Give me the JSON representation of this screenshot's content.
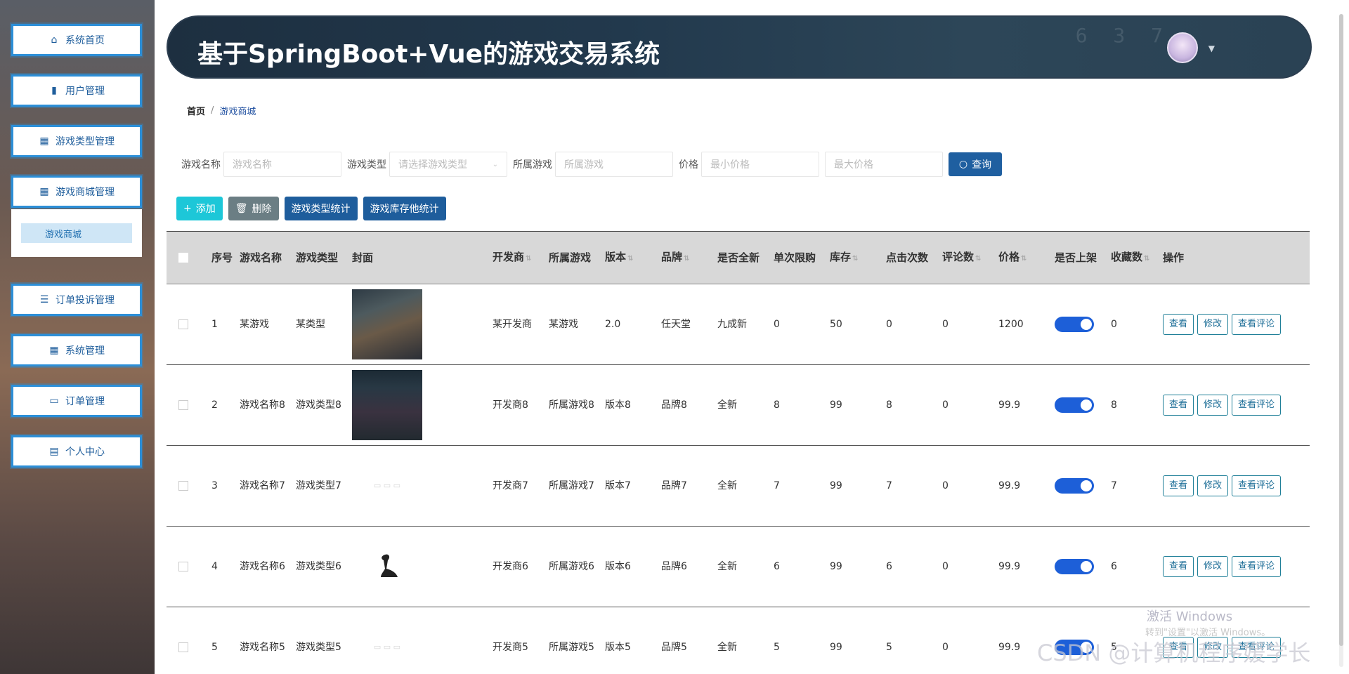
{
  "app_title": "基于SpringBoot+Vue的游戏交易系统",
  "sidebar": {
    "items": [
      {
        "label": "系统首页",
        "icon": "home-icon"
      },
      {
        "label": "用户管理",
        "icon": "bar-chart-icon"
      },
      {
        "label": "游戏类型管理",
        "icon": "grid-icon"
      },
      {
        "label": "游戏商城管理",
        "icon": "grid-icon"
      },
      {
        "label": "订单投诉管理",
        "icon": "list-icon"
      },
      {
        "label": "系统管理",
        "icon": "apps-icon"
      },
      {
        "label": "订单管理",
        "icon": "monitor-icon"
      },
      {
        "label": "个人中心",
        "icon": "calendar-icon"
      }
    ],
    "subitem": "游戏商城"
  },
  "breadcrumb": {
    "home": "首页",
    "sep": "/",
    "current": "游戏商城"
  },
  "search": {
    "name_label": "游戏名称",
    "name_placeholder": "游戏名称",
    "type_label": "游戏类型",
    "type_placeholder": "请选择游戏类型",
    "belong_label": "所属游戏",
    "belong_placeholder": "所属游戏",
    "price_label": "价格",
    "min_placeholder": "最小价格",
    "max_placeholder": "最大价格",
    "query_label": "查询"
  },
  "actions": {
    "add": "添加",
    "delete": "删除",
    "type_stat": "游戏类型统计",
    "stock_stat": "游戏库存他统计"
  },
  "table": {
    "headers": {
      "idx": "序号",
      "name": "游戏名称",
      "type": "游戏类型",
      "cover": "封面",
      "dev": "开发商",
      "belong": "所属游戏",
      "ver": "版本",
      "brand": "品牌",
      "new": "是否全新",
      "limit": "单次限购",
      "stock": "库存",
      "clicks": "点击次数",
      "comments": "评论数",
      "price": "价格",
      "onsale": "是否上架",
      "fav": "收藏数",
      "ops": "操作"
    },
    "op_labels": {
      "view": "查看",
      "edit": "修改",
      "comments": "查看评论"
    },
    "rows": [
      {
        "idx": "1",
        "name": "某游戏",
        "type": "某类型",
        "dev": "某开发商",
        "belong": "某游戏",
        "ver": "2.0",
        "brand": "任天堂",
        "new": "九成新",
        "limit": "0",
        "stock": "50",
        "clicks": "0",
        "comments": "0",
        "price": "1200",
        "fav": "0"
      },
      {
        "idx": "2",
        "name": "游戏名称8",
        "type": "游戏类型8",
        "dev": "开发商8",
        "belong": "所属游戏8",
        "ver": "版本8",
        "brand": "品牌8",
        "new": "全新",
        "limit": "8",
        "stock": "99",
        "clicks": "8",
        "comments": "0",
        "price": "99.9",
        "fav": "8"
      },
      {
        "idx": "3",
        "name": "游戏名称7",
        "type": "游戏类型7",
        "dev": "开发商7",
        "belong": "所属游戏7",
        "ver": "版本7",
        "brand": "品牌7",
        "new": "全新",
        "limit": "7",
        "stock": "99",
        "clicks": "7",
        "comments": "0",
        "price": "99.9",
        "fav": "7"
      },
      {
        "idx": "4",
        "name": "游戏名称6",
        "type": "游戏类型6",
        "dev": "开发商6",
        "belong": "所属游戏6",
        "ver": "版本6",
        "brand": "品牌6",
        "new": "全新",
        "limit": "6",
        "stock": "99",
        "clicks": "6",
        "comments": "0",
        "price": "99.9",
        "fav": "6"
      },
      {
        "idx": "5",
        "name": "游戏名称5",
        "type": "游戏类型5",
        "dev": "开发商5",
        "belong": "所属游戏5",
        "ver": "版本5",
        "brand": "品牌5",
        "new": "全新",
        "limit": "5",
        "stock": "99",
        "clicks": "5",
        "comments": "0",
        "price": "99.9",
        "fav": "5"
      }
    ]
  },
  "watermark": {
    "win1": "激活 Windows",
    "win2": "转到\"设置\"以激活 Windows。",
    "csdn": "CSDN @计算机程序媛学长"
  }
}
